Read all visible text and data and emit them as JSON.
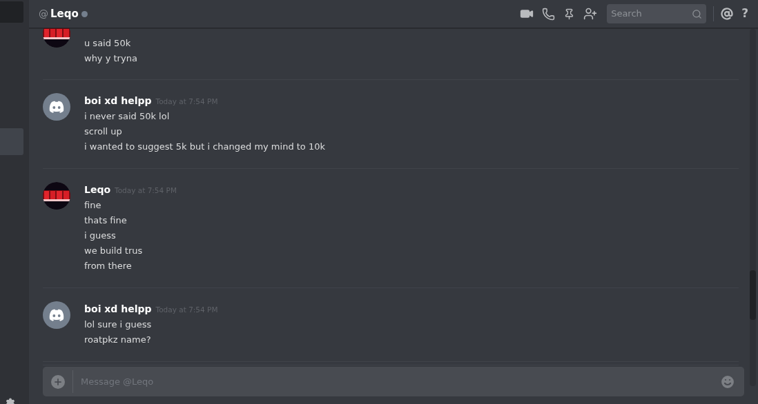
{
  "header": {
    "at": "@",
    "name": "Leqo",
    "online": false,
    "search": {
      "placeholder": "Search"
    },
    "help": "?"
  },
  "sidebar": {
    "items": [
      {
        "selected": false
      },
      {
        "selected": true
      }
    ]
  },
  "groups": [
    {
      "kind": "logo",
      "lines": [
        "u said 50k",
        "why y tryna"
      ]
    },
    {
      "kind": "default",
      "author": "boi xd helpp",
      "time": "Today at 7:54 PM",
      "lines": [
        "i never said 50k lol",
        "scroll up",
        "i wanted to suggest 5k but i changed my mind to 10k"
      ]
    },
    {
      "kind": "logo",
      "author": "Leqo",
      "time": "Today at 7:54 PM",
      "lines": [
        "fine",
        "thats fine",
        "i guess",
        "we build trus",
        "from there"
      ]
    },
    {
      "kind": "default",
      "author": "boi xd helpp",
      "time": "Today at 7:54 PM",
      "lines": [
        "lol sure i guess",
        "roatpkz name?"
      ]
    }
  ],
  "composer": {
    "placeholder": "Message @Leqo"
  }
}
